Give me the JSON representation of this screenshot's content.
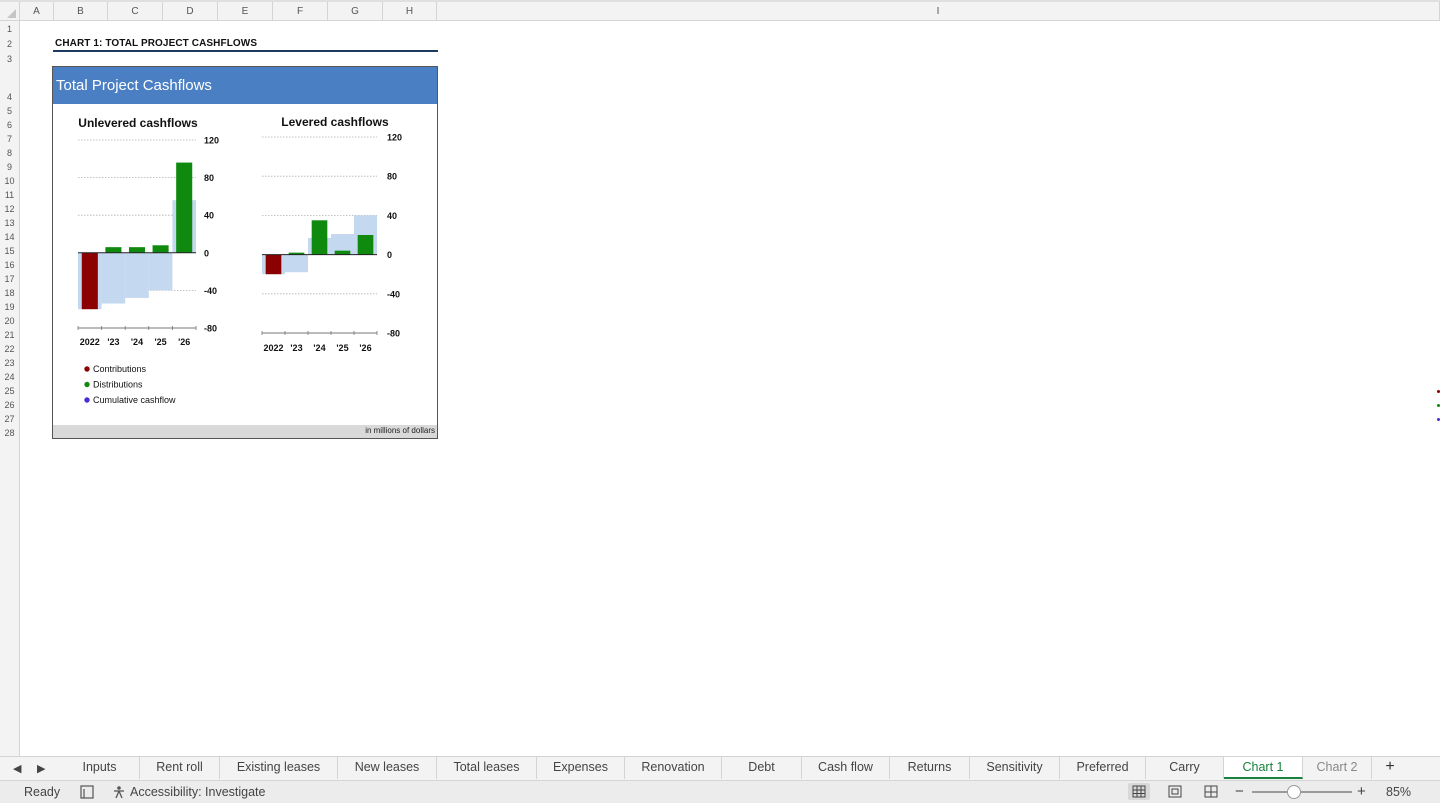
{
  "columns": [
    "A",
    "B",
    "C",
    "D",
    "E",
    "F",
    "G",
    "H",
    "I"
  ],
  "rows": [
    "1",
    "2",
    "3",
    "4",
    "5",
    "6",
    "7",
    "8",
    "9",
    "10",
    "11",
    "12",
    "13",
    "14",
    "15",
    "16",
    "17",
    "18",
    "19",
    "20",
    "21",
    "22",
    "23",
    "24",
    "25",
    "26",
    "27",
    "28"
  ],
  "sheet": {
    "section_title": "CHART 1: TOTAL PROJECT CASHFLOWS",
    "chart_banner": "Total Project Cashflows",
    "chart_footer": "in millions of dollars"
  },
  "colors": {
    "contributions": "#8b0000",
    "distributions": "#0f8a0f",
    "cumulative": "#c4d8f0",
    "cumulative_legend": "#4b2bd9",
    "banner": "#4a7fc4",
    "active_tab": "#17823b"
  },
  "chart_data": [
    {
      "type": "bar",
      "title": "Unlevered cashflows",
      "categories": [
        "2022",
        "'23",
        "'24",
        "'25",
        "'26"
      ],
      "ylim": [
        -80,
        120
      ],
      "yticks": [
        "120",
        "80",
        "40",
        "0",
        "-40",
        "-80"
      ],
      "ytick_values": [
        120,
        80,
        40,
        0,
        -40,
        -80
      ],
      "grid": true,
      "series": [
        {
          "name": "Contributions",
          "values": [
            -60,
            0,
            0,
            0,
            0
          ]
        },
        {
          "name": "Distributions",
          "values": [
            0,
            6,
            6,
            8,
            96
          ]
        },
        {
          "name": "Cumulative cashflow",
          "values": [
            -60,
            -54,
            -48,
            -40,
            56
          ]
        }
      ]
    },
    {
      "type": "bar",
      "title": "Levered cashflows",
      "categories": [
        "2022",
        "'23",
        "'24",
        "'25",
        "'26"
      ],
      "ylim": [
        -80,
        120
      ],
      "yticks": [
        "120",
        "80",
        "40",
        "0",
        "-40",
        "-80"
      ],
      "ytick_values": [
        120,
        80,
        40,
        0,
        -40,
        -80
      ],
      "grid": true,
      "series": [
        {
          "name": "Contributions",
          "values": [
            -20,
            0,
            0,
            0,
            0
          ]
        },
        {
          "name": "Distributions",
          "values": [
            0,
            2,
            35,
            4,
            20
          ]
        },
        {
          "name": "Cumulative cashflow",
          "values": [
            -20,
            -18,
            17,
            21,
            40
          ]
        }
      ]
    }
  ],
  "legend": [
    "Contributions",
    "Distributions",
    "Cumulative cashflow"
  ],
  "tabs": [
    "Inputs",
    "Rent roll",
    "Existing leases",
    "New leases",
    "Total leases",
    "Expenses",
    "Renovation",
    "Debt",
    "Cash flow",
    "Returns",
    "Sensitivity",
    "Preferred",
    "Carry",
    "Chart 1",
    "Chart 2"
  ],
  "active_tab": "Chart 1",
  "status": {
    "ready": "Ready",
    "accessibility": "Accessibility: Investigate",
    "zoom": "85%",
    "zoom_minus": "−",
    "zoom_plus": "+"
  },
  "icons": {
    "prev_sheet": "◀",
    "next_sheet": "▶",
    "add_sheet": "+"
  }
}
